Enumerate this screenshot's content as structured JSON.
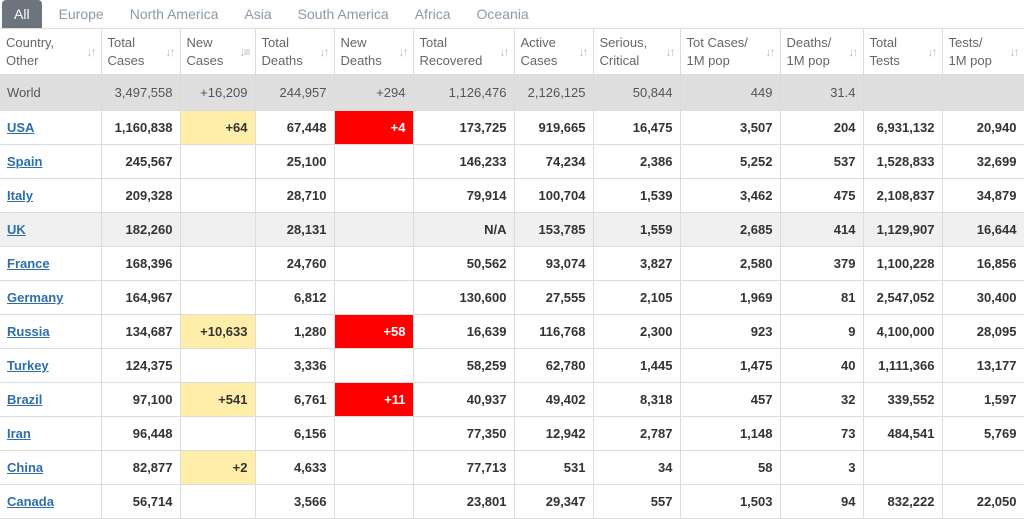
{
  "tabs": [
    "All",
    "Europe",
    "North America",
    "Asia",
    "South America",
    "Africa",
    "Oceania"
  ],
  "columns": [
    [
      "Country,",
      "Other"
    ],
    [
      "Total",
      "Cases"
    ],
    [
      "New",
      "Cases"
    ],
    [
      "Total",
      "Deaths"
    ],
    [
      "New",
      "Deaths"
    ],
    [
      "Total",
      "Recovered"
    ],
    [
      "Active",
      "Cases"
    ],
    [
      "Serious,",
      "Critical"
    ],
    [
      "Tot Cases/",
      "1M pop"
    ],
    [
      "Deaths/",
      "1M pop"
    ],
    [
      "Total",
      "Tests"
    ],
    [
      "Tests/",
      "1M pop"
    ]
  ],
  "world": [
    "World",
    "3,497,558",
    "+16,209",
    "244,957",
    "+294",
    "1,126,476",
    "2,126,125",
    "50,844",
    "449",
    "31.4",
    "",
    ""
  ],
  "rows": [
    [
      "USA",
      "1,160,838",
      "+64",
      "67,448",
      "+4",
      "173,725",
      "919,665",
      "16,475",
      "3,507",
      "204",
      "6,931,132",
      "20,940"
    ],
    [
      "Spain",
      "245,567",
      "",
      "25,100",
      "",
      "146,233",
      "74,234",
      "2,386",
      "5,252",
      "537",
      "1,528,833",
      "32,699"
    ],
    [
      "Italy",
      "209,328",
      "",
      "28,710",
      "",
      "79,914",
      "100,704",
      "1,539",
      "3,462",
      "475",
      "2,108,837",
      "34,879"
    ],
    [
      "UK",
      "182,260",
      "",
      "28,131",
      "",
      "N/A",
      "153,785",
      "1,559",
      "2,685",
      "414",
      "1,129,907",
      "16,644"
    ],
    [
      "France",
      "168,396",
      "",
      "24,760",
      "",
      "50,562",
      "93,074",
      "3,827",
      "2,580",
      "379",
      "1,100,228",
      "16,856"
    ],
    [
      "Germany",
      "164,967",
      "",
      "6,812",
      "",
      "130,600",
      "27,555",
      "2,105",
      "1,969",
      "81",
      "2,547,052",
      "30,400"
    ],
    [
      "Russia",
      "134,687",
      "+10,633",
      "1,280",
      "+58",
      "16,639",
      "116,768",
      "2,300",
      "923",
      "9",
      "4,100,000",
      "28,095"
    ],
    [
      "Turkey",
      "124,375",
      "",
      "3,336",
      "",
      "58,259",
      "62,780",
      "1,445",
      "1,475",
      "40",
      "1,111,366",
      "13,177"
    ],
    [
      "Brazil",
      "97,100",
      "+541",
      "6,761",
      "+11",
      "40,937",
      "49,402",
      "8,318",
      "457",
      "32",
      "339,552",
      "1,597"
    ],
    [
      "Iran",
      "96,448",
      "",
      "6,156",
      "",
      "77,350",
      "12,942",
      "2,787",
      "1,148",
      "73",
      "484,541",
      "5,769"
    ],
    [
      "China",
      "82,877",
      "+2",
      "4,633",
      "",
      "77,713",
      "531",
      "34",
      "58",
      "3",
      "",
      ""
    ],
    [
      "Canada",
      "56,714",
      "",
      "3,566",
      "",
      "23,801",
      "29,347",
      "557",
      "1,503",
      "94",
      "832,222",
      "22,050"
    ]
  ],
  "colors": {
    "new_cases_highlight": "#ffeeaa",
    "new_deaths_highlight": "#ff0000",
    "link": "#2f6ea8",
    "world_row_bg": "#dfdfdf",
    "active_tab_bg": "#6c757d"
  }
}
